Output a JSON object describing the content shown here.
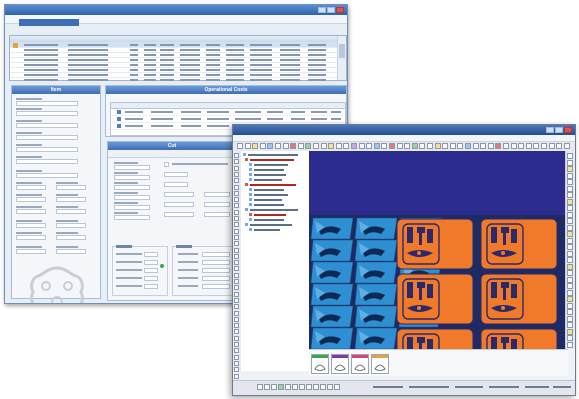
{
  "erp_window": {
    "title": "",
    "menu": [
      "",
      "",
      ""
    ],
    "order_grid": {
      "row_count": 8,
      "selected_row": 0
    },
    "item_panel": {
      "header": "Item",
      "fields": [
        "",
        "",
        "",
        "",
        "",
        "",
        "",
        ""
      ]
    },
    "operational_costs": {
      "header": "Operational Costs",
      "rows": [
        "",
        "",
        ""
      ]
    },
    "cut_window": {
      "header": "Cut",
      "group_left": "",
      "group_right": ""
    }
  },
  "cad_window": {
    "title": "",
    "menu": [
      "",
      "",
      "",
      "",
      "",
      "",
      "",
      "",
      ""
    ],
    "layer_tree": {
      "rows": 16,
      "selected": [
        1,
        6,
        12
      ]
    },
    "canvas": {
      "background": "#1e2a63",
      "band_color": "#2c2c8e",
      "blue_parts_color": "#2f8fd3",
      "orange_parts_color": "#f07a2a",
      "orange_grid": {
        "columns": 2,
        "rows": 3
      },
      "blue_grid": {
        "columns": 3,
        "rows": 6
      }
    },
    "thumbnails": [
      {
        "color": "#3aa84a"
      },
      {
        "color": "#7d3aa8"
      },
      {
        "color": "#d8457a"
      },
      {
        "color": "#e8a23a"
      }
    ],
    "status_text": ""
  }
}
